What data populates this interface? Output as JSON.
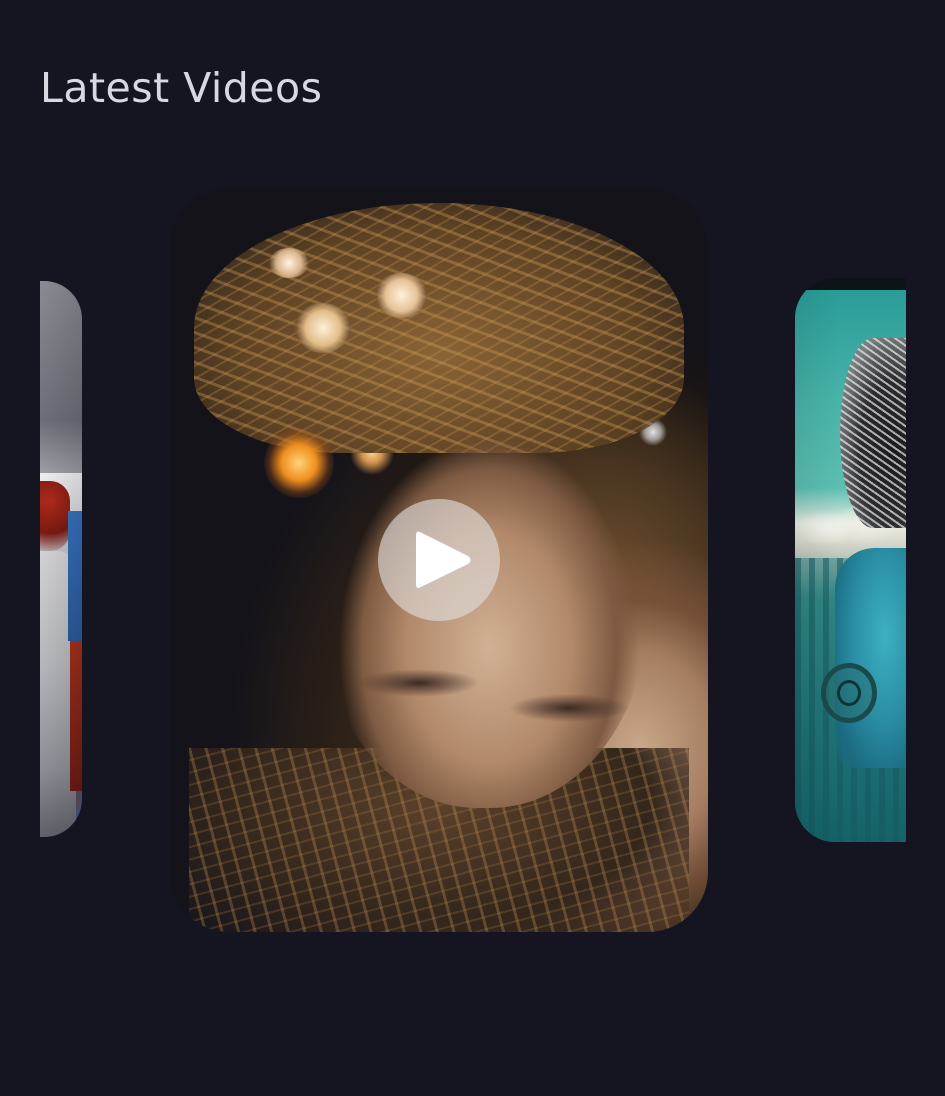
{
  "section": {
    "title": "Latest Videos"
  },
  "carousel": {
    "active_index": 1,
    "videos": [
      {
        "position": "previous",
        "thumbnail": "abstract-figure-artwork"
      },
      {
        "position": "current",
        "thumbnail": "cyborg-woman-portrait",
        "play_icon": "play-icon"
      },
      {
        "position": "next",
        "thumbnail": "teal-character-artwork"
      }
    ]
  },
  "colors": {
    "background": "#151522",
    "title_text": "#d8d8e0",
    "play_button_bg": "#e1dede",
    "play_icon": "#ffffff"
  }
}
